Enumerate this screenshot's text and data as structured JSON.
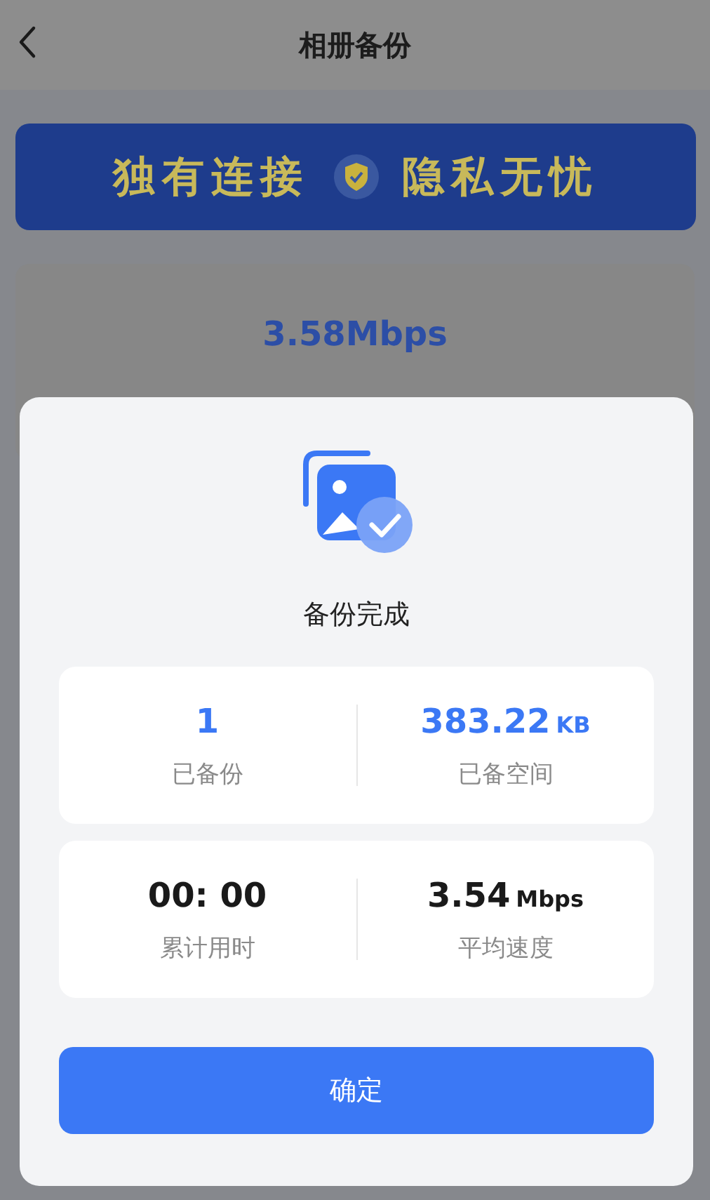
{
  "header": {
    "title": "相册备份"
  },
  "banner": {
    "left_text": "独有连接",
    "right_text": "隐私无忧"
  },
  "background_card": {
    "speed": "3.58Mbps"
  },
  "dialog": {
    "title": "备份完成",
    "stat_groups": [
      {
        "stats": [
          {
            "value": "1",
            "label": "已备份",
            "accent": true
          },
          {
            "value": "383.22",
            "unit": "KB",
            "label": "已备空间",
            "accent": true
          }
        ]
      },
      {
        "stats": [
          {
            "value": "00: 00",
            "label": "累计用时",
            "accent": false
          },
          {
            "value": "3.54",
            "unit": "Mbps",
            "label": "平均速度",
            "accent": false
          }
        ]
      }
    ],
    "confirm_button": "确定"
  }
}
